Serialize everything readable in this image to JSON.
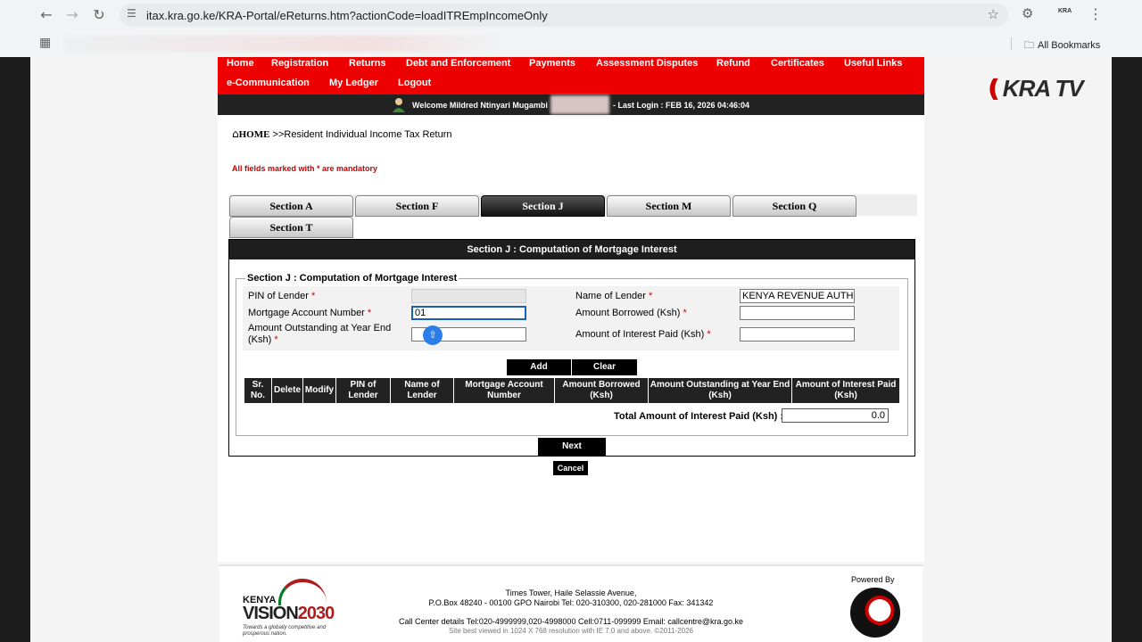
{
  "browser": {
    "url": "itax.kra.go.ke/KRA-Portal/eReturns.htm?actionCode=loadITREmpIncomeOnly",
    "profile_label": "KRA",
    "all_bookmarks": "All Bookmarks"
  },
  "watermark": "KRA TV",
  "menu": {
    "row1": [
      "Home",
      "Registration",
      "Returns",
      "Debt and Enforcement",
      "Payments",
      "Assessment Disputes",
      "Refund",
      "Certificates",
      "Useful Links"
    ],
    "row2": [
      "e-Communication",
      "My Ledger",
      "Logout"
    ]
  },
  "welcome": {
    "text": "Welcome Mildred Ntinyari Mugambi",
    "last_login": "- Last Login : FEB 16, 2026 04:46:04"
  },
  "breadcrumb": {
    "home": "HOME",
    "path": ">>Resident Individual Income Tax Return"
  },
  "mandatory_note": "All fields marked with * are mandatory",
  "tabs": [
    "Section A",
    "Section F",
    "Section J",
    "Section M",
    "Section Q",
    "Section T"
  ],
  "active_tab": "Section J",
  "section": {
    "header": "Section J : Computation of Mortgage Interest",
    "legend": "Section J : Computation of Mortgage Interest",
    "fields": {
      "pin_label": "PIN of Lender",
      "pin_value": "",
      "lender_name_label": "Name of Lender",
      "lender_name_value": "KENYA REVENUE AUTH",
      "account_label": "Mortgage Account Number",
      "account_value": "01",
      "borrowed_label": "Amount Borrowed (Ksh)",
      "borrowed_value": "",
      "outstanding_label": "Amount Outstanding at Year End (Ksh)",
      "outstanding_value": "",
      "interest_label": "Amount of Interest Paid (Ksh)",
      "interest_value": ""
    },
    "required_marker": "*",
    "add_label": "Add",
    "clear_label": "Clear",
    "columns": [
      "Sr. No.",
      "Delete",
      "Modify",
      "PIN of Lender",
      "Name of Lender",
      "Mortgage Account Number",
      "Amount Borrowed (Ksh)",
      "Amount Outstanding at Year End (Ksh)",
      "Amount of Interest Paid (Ksh)"
    ],
    "total_label": "Total Amount of Interest Paid (Ksh) :",
    "total_value": "0.0"
  },
  "next_label": "Next",
  "cancel_label": "Cancel",
  "footer": {
    "vision_kenya": "KENYA",
    "vision_word": "VISION",
    "vision_year": "2030",
    "vision_tagline": "Towards a globally competitive and prosperous nation.",
    "address1": "Times Tower, Haile Selassie Avenue,",
    "address2": "P.O.Box 48240 - 00100 GPO Nairobi Tel: 020-310300, 020-281000 Fax: 341342",
    "callcenter": "Call Center details Tel:020-4999999,020-4998000 Cell:0711-099999 Email: callcentre@kra.go.ke",
    "best_viewed": "Site best viewed in 1024 X 768 resolution with IE 7.0 and above. ©2011-2026",
    "powered_by": "Powered By"
  },
  "colors": {
    "menu_red": "#ee0000",
    "dark_bar": "#222222",
    "required_red": "#cc0000",
    "focus_blue": "#1a5fb4"
  }
}
